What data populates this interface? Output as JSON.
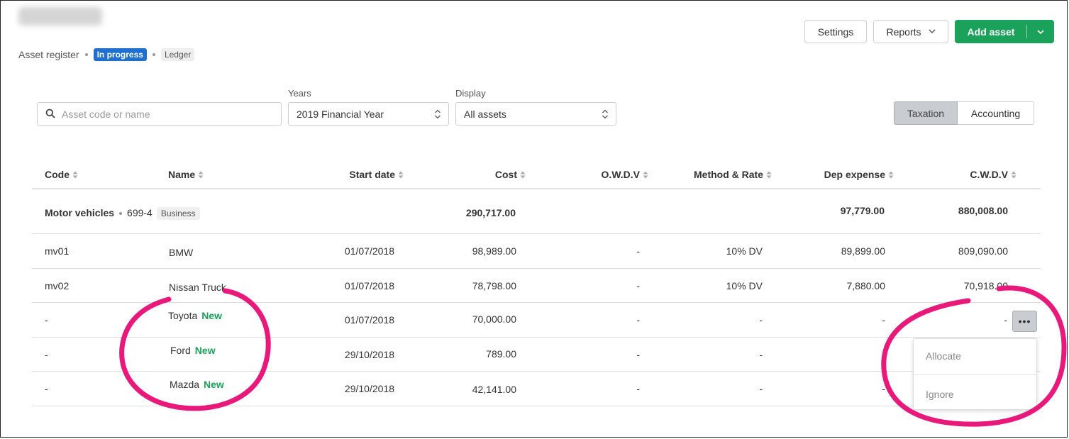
{
  "breadcrumb": {
    "root": "Asset register",
    "status": "In progress",
    "ledger": "Ledger"
  },
  "header": {
    "settings": "Settings",
    "reports": "Reports",
    "add_asset": "Add asset"
  },
  "filters": {
    "search_placeholder": "Asset code or name",
    "years_label": "Years",
    "years_value": "2019 Financial Year",
    "display_label": "Display",
    "display_value": "All assets"
  },
  "view_toggle": {
    "taxation": "Taxation",
    "accounting": "Accounting",
    "selected": "Taxation"
  },
  "table": {
    "columns": [
      "Code",
      "Name",
      "Start date",
      "Cost",
      "O.W.D.V",
      "Method & Rate",
      "Dep expense",
      "C.W.D.V"
    ],
    "group": {
      "name": "Motor vehicles",
      "code": "699-4",
      "badge": "Business",
      "cost": "290,717.00",
      "dep_expense": "97,779.00",
      "cwdv": "880,008.00"
    },
    "rows": [
      {
        "code": "mv01",
        "name": "BMW",
        "new": "",
        "start": "01/07/2018",
        "cost": "98,989.00",
        "owdv": "-",
        "method": "10% DV",
        "dep": "89,899.00",
        "cwdv": "809,090.00"
      },
      {
        "code": "mv02",
        "name": "Nissan Truck",
        "new": "",
        "start": "01/07/2018",
        "cost": "78,798.00",
        "owdv": "-",
        "method": "10% DV",
        "dep": "7,880.00",
        "cwdv": "70,918.00"
      },
      {
        "code": "-",
        "name": "Toyota",
        "new": "New",
        "start": "01/07/2018",
        "cost": "70,000.00",
        "owdv": "-",
        "method": "-",
        "dep": "-",
        "cwdv": "-"
      },
      {
        "code": "-",
        "name": "Ford",
        "new": "New",
        "start": "29/10/2018",
        "cost": "789.00",
        "owdv": "-",
        "method": "-",
        "dep": "",
        "cwdv": ""
      },
      {
        "code": "-",
        "name": "Mazda",
        "new": "New",
        "start": "29/10/2018",
        "cost": "42,141.00",
        "owdv": "-",
        "method": "-",
        "dep": "-",
        "cwdv": ""
      }
    ]
  },
  "row_menu": {
    "button": "•••",
    "items": [
      "Allocate",
      "Ignore"
    ]
  },
  "colors": {
    "accent_green": "#1aa25a",
    "status_blue": "#1f6fd1",
    "annotation_pink": "#e8197a"
  }
}
